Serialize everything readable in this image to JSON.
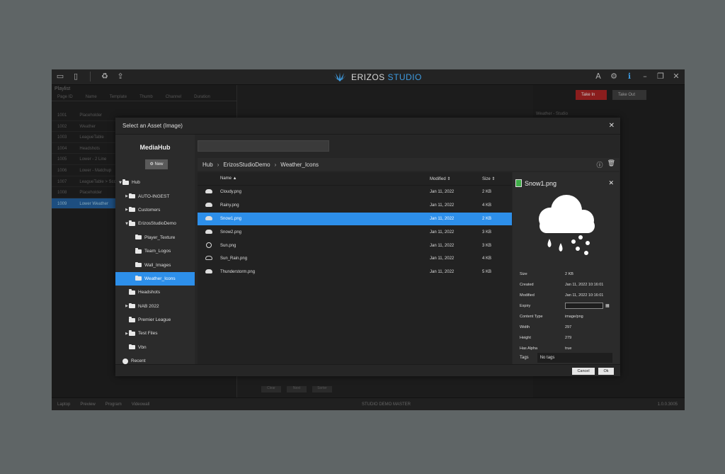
{
  "app": {
    "brand_left": "ERIZOS",
    "brand_right": "STUDIO",
    "accent": "#3e9be0"
  },
  "background": {
    "left_panel_title": "Playlist",
    "columns": [
      "Page ID",
      "Name",
      "Template",
      "Thumb",
      "Channel",
      "Duration"
    ],
    "rows": [
      {
        "id": "1001",
        "name": "Placeholder"
      },
      {
        "id": "1002",
        "name": "Weather"
      },
      {
        "id": "1003",
        "name": "LeagueTable"
      },
      {
        "id": "1004",
        "name": "Headshots"
      },
      {
        "id": "1005",
        "name": "Lower - 2 Line"
      },
      {
        "id": "1006",
        "name": "Lower - Matchup"
      },
      {
        "id": "1007",
        "name": "LeagueTable > Score"
      },
      {
        "id": "1008",
        "name": "Placeholder"
      },
      {
        "id": "1009",
        "name": "Lower Weather",
        "selected": true
      }
    ],
    "take_in": "Take In",
    "take_out": "Take Out",
    "weather_label": "Weather - Studio",
    "mid_buttons": [
      "Clear",
      "Next",
      "Sorter"
    ],
    "statusbar": {
      "device": "Laptop",
      "preview": "Preview",
      "program": "Program",
      "videowall": "Videowall",
      "center": "STUDIO DEMO MASTER",
      "version": "1.0.0.3005"
    }
  },
  "modal": {
    "title": "Select an Asset (Image)",
    "sidebar_title": "MediaHub",
    "new_button": "New",
    "tree": [
      {
        "label": "Hub",
        "level": 0,
        "caret": "▼",
        "type": "folder"
      },
      {
        "label": "AUTO-INGEST",
        "level": 1,
        "caret": "▶",
        "type": "folder"
      },
      {
        "label": "Customers",
        "level": 1,
        "caret": "▶",
        "type": "folder"
      },
      {
        "label": "ErizosStudioDemo",
        "level": 1,
        "caret": "▼",
        "type": "folder"
      },
      {
        "label": "Player_Texture",
        "level": 2,
        "caret": "",
        "type": "folder"
      },
      {
        "label": "Team_Logos",
        "level": 2,
        "caret": "",
        "type": "folder"
      },
      {
        "label": "Wall_Images",
        "level": 2,
        "caret": "",
        "type": "folder"
      },
      {
        "label": "Weather_Icons",
        "level": 2,
        "caret": "",
        "type": "folder",
        "selected": true
      },
      {
        "label": "Headshots",
        "level": 1,
        "caret": "",
        "type": "folder"
      },
      {
        "label": "NAB 2022",
        "level": 1,
        "caret": "▶",
        "type": "folder"
      },
      {
        "label": "Premier League",
        "level": 1,
        "caret": "",
        "type": "folder"
      },
      {
        "label": "Test Files",
        "level": 1,
        "caret": "▶",
        "type": "folder"
      },
      {
        "label": "Vbn",
        "level": 1,
        "caret": "",
        "type": "folder"
      },
      {
        "label": "Recent",
        "level": 0,
        "caret": "",
        "type": "recent"
      }
    ],
    "breadcrumb": [
      "Hub",
      "ErizosStudioDemo",
      "Weather_Icons"
    ],
    "breadcrumb_sep": "›",
    "list_headers": {
      "name": "Name ▲",
      "modified": "Modified ⇕",
      "size": "Size ⇕"
    },
    "files": [
      {
        "name": "Cloudy.png",
        "modified": "Jan 11, 2022",
        "size": "2 KB",
        "icon": "cloud-icon"
      },
      {
        "name": "Rainy.png",
        "modified": "Jan 11, 2022",
        "size": "4 KB",
        "icon": "rain-icon"
      },
      {
        "name": "Snow1.png",
        "modified": "Jan 11, 2022",
        "size": "2 KB",
        "icon": "snow-icon",
        "selected": true
      },
      {
        "name": "Snow2.png",
        "modified": "Jan 11, 2022",
        "size": "3 KB",
        "icon": "snow-icon"
      },
      {
        "name": "Sun.png",
        "modified": "Jan 11, 2022",
        "size": "3 KB",
        "icon": "sun-icon"
      },
      {
        "name": "Sun_Rain.png",
        "modified": "Jan 11, 2022",
        "size": "4 KB",
        "icon": "sun-rain-icon"
      },
      {
        "name": "Thunderstorm.png",
        "modified": "Jan 11, 2022",
        "size": "5 KB",
        "icon": "storm-icon"
      }
    ],
    "detail": {
      "filename": "Snow1.png",
      "props": [
        {
          "k": "Size",
          "v": "2 KB"
        },
        {
          "k": "Created",
          "v": "Jan 11, 2022 10:16:01"
        },
        {
          "k": "Modified",
          "v": "Jan 11, 2022 10:16:01"
        },
        {
          "k": "Expiry",
          "v": ""
        },
        {
          "k": "Content Type",
          "v": "image/png"
        },
        {
          "k": "Width",
          "v": "297"
        },
        {
          "k": "Height",
          "v": "279"
        },
        {
          "k": "Has Alpha",
          "v": "true"
        }
      ],
      "tags_label": "Tags",
      "tags_value": "No tags"
    },
    "cancel": "Cancel",
    "ok": "Ok",
    "selection_color": "#2d8fea"
  }
}
